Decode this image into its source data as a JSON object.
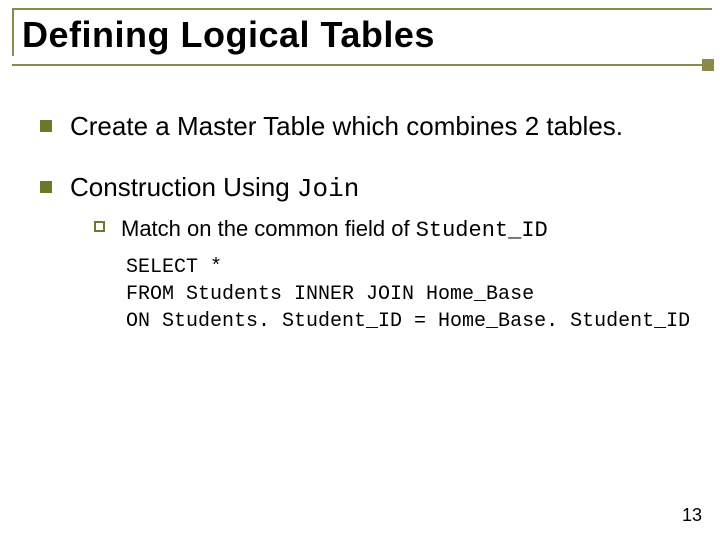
{
  "title": "Defining Logical Tables",
  "bullets": [
    {
      "type": "plain",
      "text": "Create a Master Table which combines 2 tables."
    },
    {
      "type": "join",
      "prefix": "Construction Using ",
      "code": "Join"
    }
  ],
  "sub": {
    "prefix": "Match on the common field of ",
    "code": "Student_ID"
  },
  "sql": "SELECT *\nFROM Students INNER JOIN Home_Base\nON Students. Student_ID = Home_Base. Student_ID",
  "page": "13"
}
